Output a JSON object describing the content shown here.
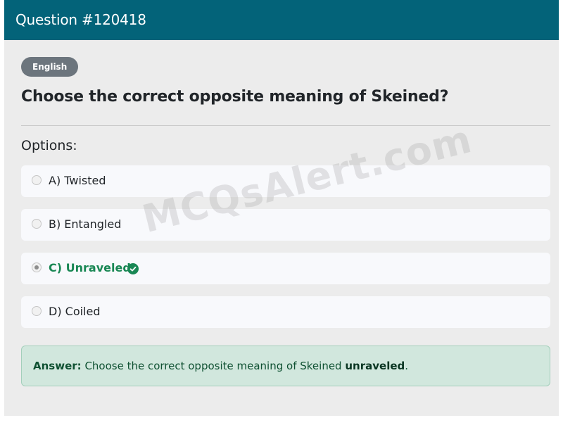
{
  "header": {
    "title": "Question #120418"
  },
  "language_badge": "English",
  "question": "Choose the correct opposite meaning of Skeined?",
  "options_label": "Options:",
  "options": [
    {
      "label": "A) Twisted",
      "selected": false,
      "correct": false
    },
    {
      "label": "B) Entangled",
      "selected": false,
      "correct": false
    },
    {
      "label": "C) Unraveled",
      "selected": true,
      "correct": true,
      "icon": "check-circle-icon"
    },
    {
      "label": "D) Coiled",
      "selected": false,
      "correct": false
    }
  ],
  "answer": {
    "label": "Answer:",
    "text": "Choose the correct opposite meaning of Skeined",
    "answer_word": "unraveled",
    "suffix": "."
  },
  "watermark": "MCQsAlert.com",
  "colors": {
    "header_bg": "#036379",
    "correct": "#198754",
    "answer_bg": "#d1e7dd",
    "badge_bg": "#6c757d"
  }
}
